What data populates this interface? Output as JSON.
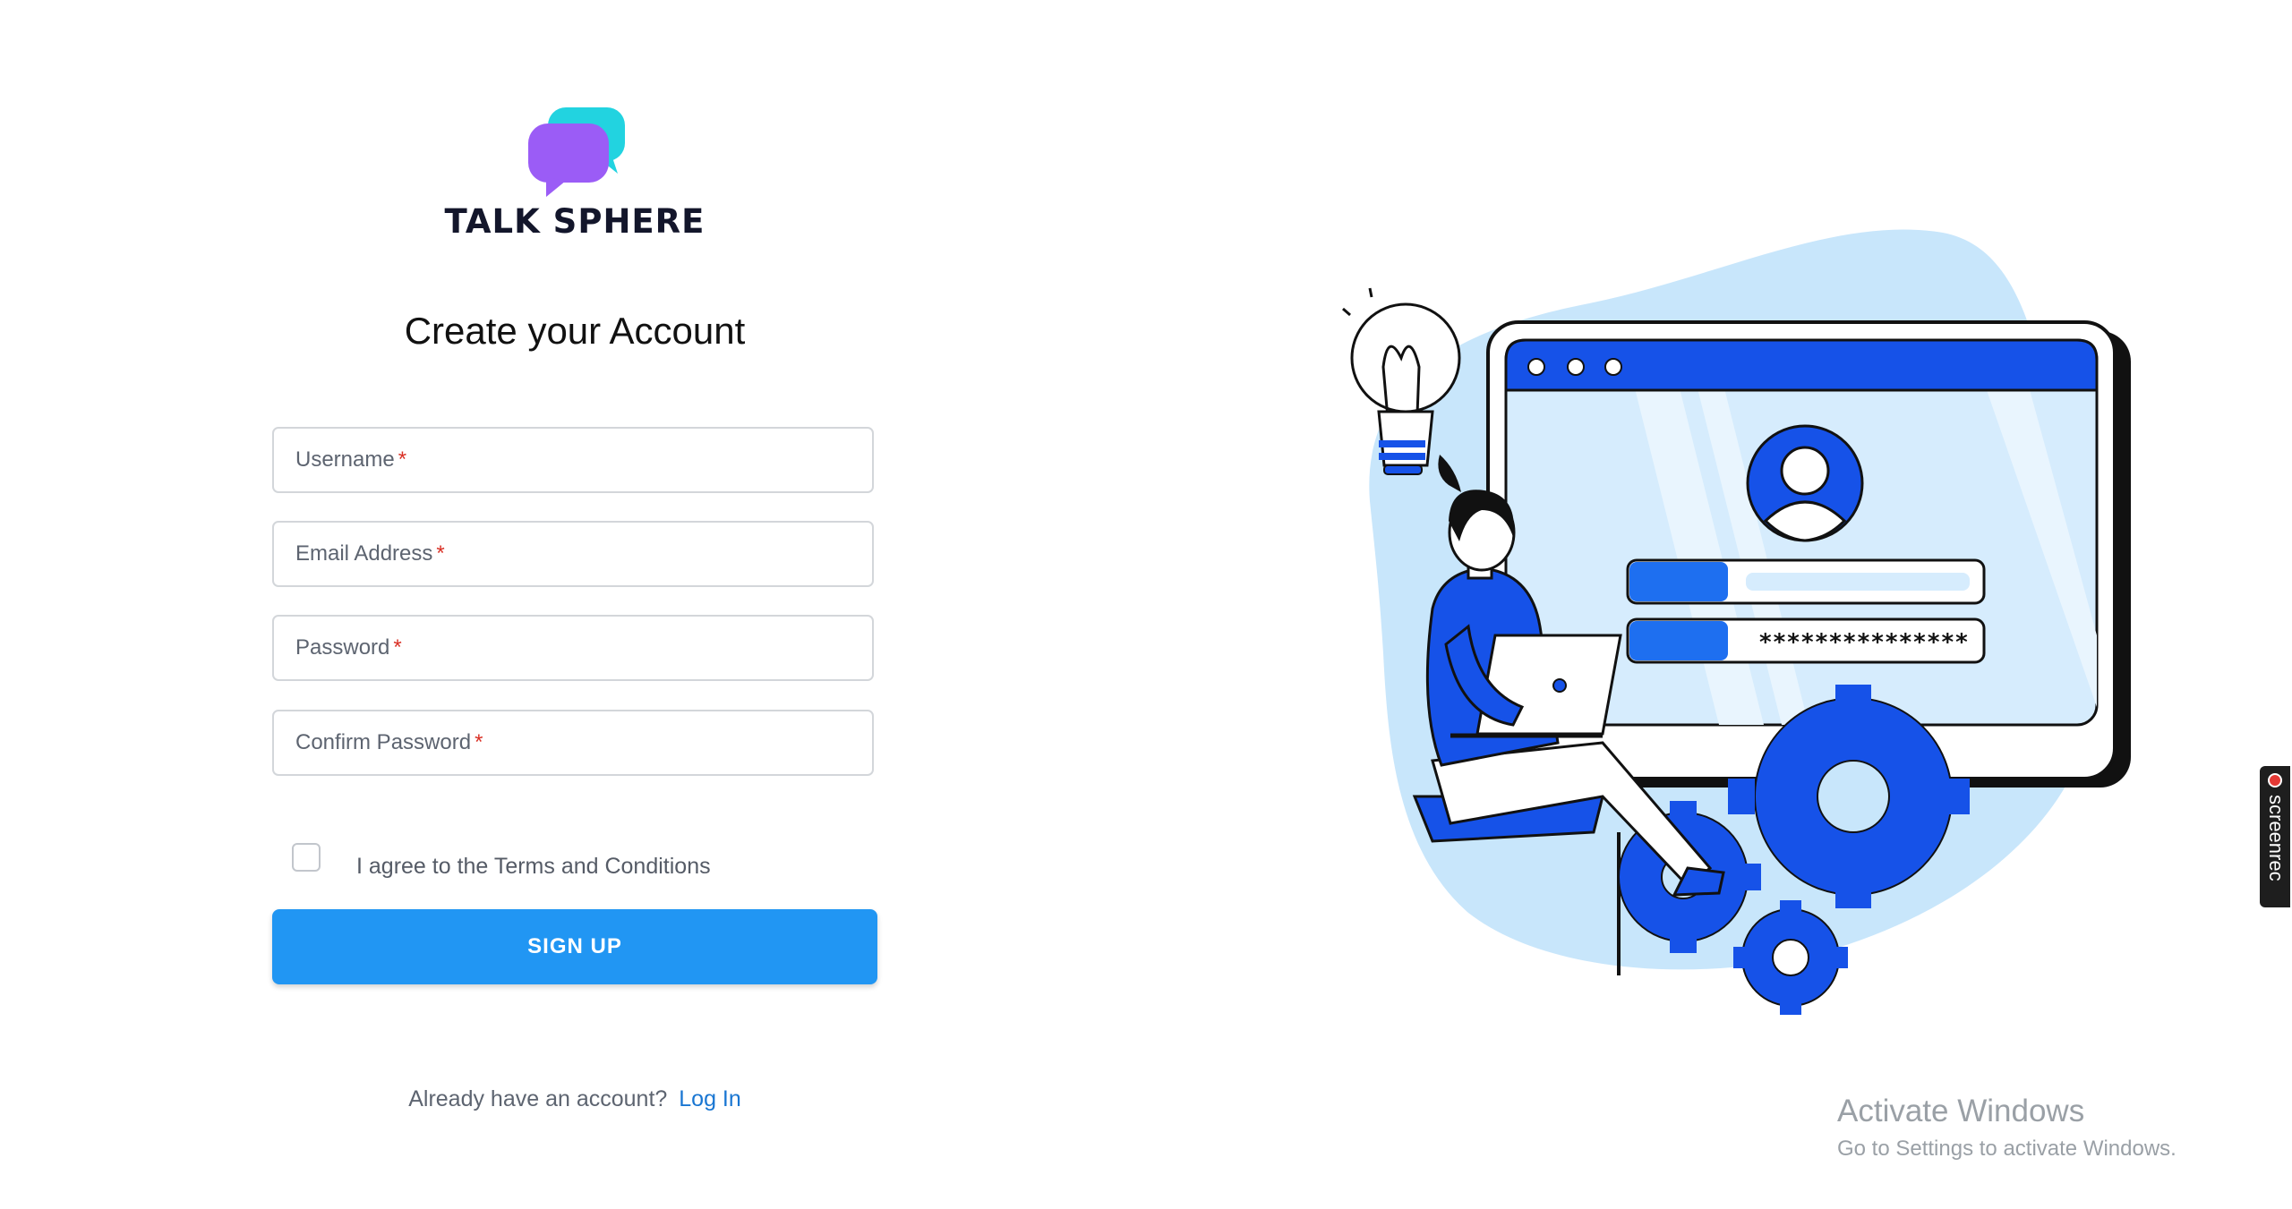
{
  "brand": {
    "name": "TALK SPHERE",
    "logo_icon": "chat-bubbles-icon",
    "colors": {
      "bubble_front": "#9b5cf6",
      "bubble_back": "#22d3e0"
    }
  },
  "form": {
    "heading": "Create your Account",
    "fields": [
      {
        "label": "Username",
        "required": "*"
      },
      {
        "label": "Email Address",
        "required": "*"
      },
      {
        "label": "Password",
        "required": "*"
      },
      {
        "label": "Confirm Password",
        "required": "*"
      }
    ],
    "terms_label": "I agree to the Terms and Conditions",
    "submit_label": "SIGN UP",
    "login_prompt": "Already have an account?",
    "login_link": "Log In"
  },
  "illustration": {
    "password_mask": "***************",
    "icon": "login-illustration-icon"
  },
  "screenrec": {
    "label": "screenrec"
  },
  "watermark": {
    "title": "Activate Windows",
    "subtitle": "Go to Settings to activate Windows."
  },
  "colors": {
    "primary": "#2196f3",
    "link": "#1976d2",
    "required": "#d93025",
    "illustration_blue": "#1652e8",
    "illustration_bg": "#c8e6fb"
  }
}
